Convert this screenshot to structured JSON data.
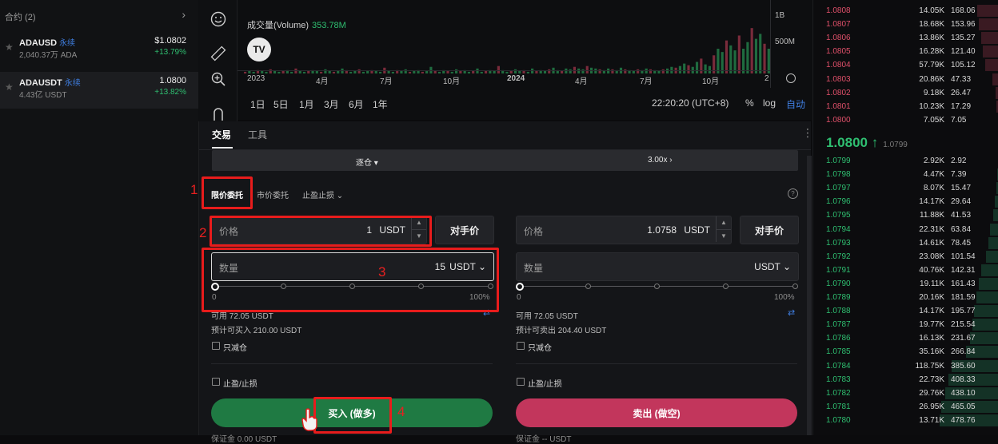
{
  "sidebar": {
    "header": "合约 (2)",
    "pairs": [
      {
        "symbol": "ADAUSD",
        "tag": "永续",
        "sub": "2,040.37万 ADA",
        "price": "$1.0802",
        "change": "+13.79%"
      },
      {
        "symbol": "ADAUSDT",
        "tag": "永续",
        "sub": "4.43亿 USDT",
        "price": "1.0800",
        "change": "+13.82%"
      }
    ]
  },
  "chart": {
    "volume_label": "成交量(Volume)",
    "volume_value": "353.78M",
    "logo_text": "TV",
    "right_axis": [
      "1B",
      "500M"
    ],
    "x_axis": [
      "2023",
      "4月",
      "7月",
      "10月",
      "2024",
      "4月",
      "7月",
      "10月",
      "2"
    ],
    "timeframes": [
      "1日",
      "5日",
      "1月",
      "3月",
      "6月",
      "1年"
    ],
    "clock": "22:20:20 (UTC+8)",
    "opt_pct": "%",
    "opt_log": "log",
    "opt_auto": "自动",
    "volume_bars": [
      2,
      3,
      2,
      4,
      3,
      2,
      5,
      3,
      2,
      3,
      4,
      2,
      6,
      3,
      2,
      3,
      4,
      3,
      2,
      5,
      3,
      2,
      3,
      6,
      4,
      2,
      3,
      5,
      2,
      3,
      4,
      3,
      2,
      7,
      3,
      2,
      4,
      3,
      5,
      2,
      3,
      4,
      2,
      3,
      8,
      3,
      2,
      4,
      3,
      2,
      5,
      3,
      4,
      2,
      3,
      6,
      2,
      3,
      4,
      3,
      9,
      4,
      2,
      3,
      5,
      3,
      4,
      2,
      6,
      3,
      4,
      3,
      5,
      7,
      4,
      3,
      6,
      5,
      8,
      6,
      5,
      9,
      7,
      6,
      5,
      4,
      6,
      5,
      4,
      7,
      5,
      4,
      3,
      5,
      4,
      6,
      5,
      4,
      3,
      5,
      6,
      8,
      7,
      9,
      12,
      10,
      8,
      14,
      18,
      11,
      9,
      22,
      30,
      26,
      40,
      34,
      28,
      46,
      30,
      38,
      55,
      42,
      48,
      36,
      30
    ]
  },
  "trade": {
    "tabs": [
      "交易",
      "工具"
    ],
    "leverage_mode": "逐仓 ▾",
    "leverage_value": "3.00x ›",
    "order_types": [
      "限价委托",
      "市价委托",
      "止盈止损 ⌄"
    ],
    "info_icon": "?",
    "buy": {
      "price_label": "价格",
      "price_value": "1",
      "price_unit": "USDT",
      "counterparty": "对手价",
      "qty_label": "数量",
      "qty_value": "15",
      "qty_unit": "USDT ⌄",
      "pct_min": "0",
      "pct_max": "100%",
      "available": "可用 72.05 USDT",
      "estimate": "预计可买入 210.00 USDT",
      "reduce_only": "只减仓",
      "tpsl": "止盈/止损",
      "action": "买入 (做多)",
      "margin": "保证金 0.00 USDT"
    },
    "sell": {
      "price_label": "价格",
      "price_value": "1.0758",
      "price_unit": "USDT",
      "counterparty": "对手价",
      "qty_label": "数量",
      "qty_value": "",
      "qty_unit": "USDT ⌄",
      "pct_min": "0",
      "pct_max": "100%",
      "available": "可用 72.05 USDT",
      "estimate": "预计可卖出 204.40 USDT",
      "reduce_only": "只减仓",
      "tpsl": "止盈/止损",
      "action": "卖出 (做空)",
      "margin": "保证金 -- USDT"
    }
  },
  "annotations": [
    "1",
    "2",
    "3",
    "4"
  ],
  "orderbook": {
    "asks": [
      {
        "p": "1.0808",
        "s": "14.05K",
        "t": "168.06",
        "w": 0.3
      },
      {
        "p": "1.0807",
        "s": "18.68K",
        "t": "153.96",
        "w": 0.28
      },
      {
        "p": "1.0806",
        "s": "13.86K",
        "t": "135.27",
        "w": 0.25
      },
      {
        "p": "1.0805",
        "s": "16.28K",
        "t": "121.40",
        "w": 0.22
      },
      {
        "p": "1.0804",
        "s": "57.79K",
        "t": "105.12",
        "w": 0.19
      },
      {
        "p": "1.0803",
        "s": "20.86K",
        "t": "47.33",
        "w": 0.09
      },
      {
        "p": "1.0802",
        "s": "9.18K",
        "t": "26.47",
        "w": 0.05
      },
      {
        "p": "1.0801",
        "s": "10.23K",
        "t": "17.29",
        "w": 0.03
      },
      {
        "p": "1.0800",
        "s": "7.05K",
        "t": "7.05",
        "w": 0.01
      }
    ],
    "mid_price": "1.0800 ↑",
    "mid_sub": "1.0799",
    "bids": [
      {
        "p": "1.0799",
        "s": "2.92K",
        "t": "2.92",
        "w": 0.01
      },
      {
        "p": "1.0798",
        "s": "4.47K",
        "t": "7.39",
        "w": 0.02
      },
      {
        "p": "1.0797",
        "s": "8.07K",
        "t": "15.47",
        "w": 0.03
      },
      {
        "p": "1.0796",
        "s": "14.17K",
        "t": "29.64",
        "w": 0.06
      },
      {
        "p": "1.0795",
        "s": "11.88K",
        "t": "41.53",
        "w": 0.08
      },
      {
        "p": "1.0794",
        "s": "22.31K",
        "t": "63.84",
        "w": 0.12
      },
      {
        "p": "1.0793",
        "s": "14.61K",
        "t": "78.45",
        "w": 0.14
      },
      {
        "p": "1.0792",
        "s": "23.08K",
        "t": "101.54",
        "w": 0.18
      },
      {
        "p": "1.0791",
        "s": "40.76K",
        "t": "142.31",
        "w": 0.25
      },
      {
        "p": "1.0790",
        "s": "19.11K",
        "t": "161.43",
        "w": 0.28
      },
      {
        "p": "1.0789",
        "s": "20.16K",
        "t": "181.59",
        "w": 0.31
      },
      {
        "p": "1.0788",
        "s": "14.17K",
        "t": "195.77",
        "w": 0.34
      },
      {
        "p": "1.0787",
        "s": "19.77K",
        "t": "215.54",
        "w": 0.37
      },
      {
        "p": "1.0786",
        "s": "16.13K",
        "t": "231.67",
        "w": 0.4
      },
      {
        "p": "1.0785",
        "s": "35.16K",
        "t": "266.84",
        "w": 0.46
      },
      {
        "p": "1.0784",
        "s": "118.75K",
        "t": "385.60",
        "w": 0.66
      },
      {
        "p": "1.0783",
        "s": "22.73K",
        "t": "408.33",
        "w": 0.7
      },
      {
        "p": "1.0782",
        "s": "29.76K",
        "t": "438.10",
        "w": 0.75
      },
      {
        "p": "1.0781",
        "s": "26.95K",
        "t": "465.05",
        "w": 0.8
      },
      {
        "p": "1.0780",
        "s": "13.71K",
        "t": "478.76",
        "w": 0.82
      }
    ]
  }
}
